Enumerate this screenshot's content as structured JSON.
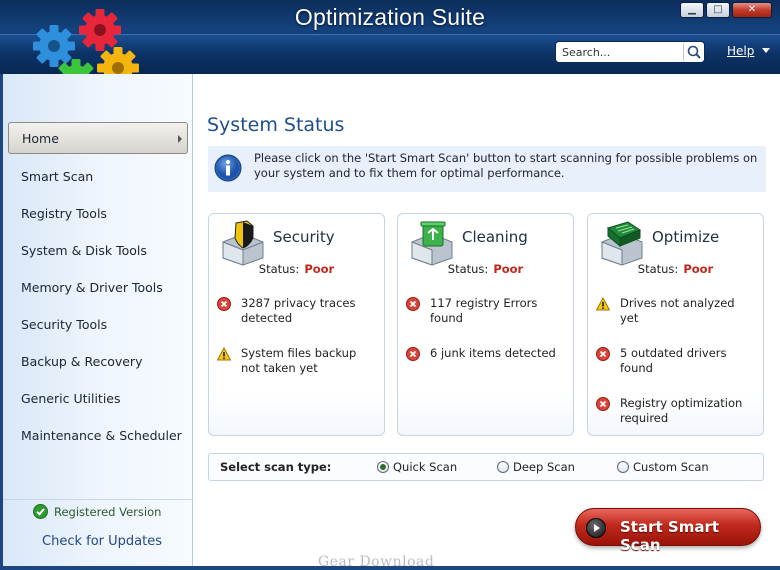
{
  "window": {
    "title": "Optimization Suite",
    "controls": {
      "minimize": "▁",
      "maximize": "□",
      "close": "✕"
    }
  },
  "header": {
    "search": {
      "placeholder": "Search...",
      "value": ""
    },
    "help_label": "Help"
  },
  "sidebar": {
    "items": [
      {
        "label": "Home",
        "active": true
      },
      {
        "label": "Smart Scan"
      },
      {
        "label": "Registry Tools"
      },
      {
        "label": "System & Disk Tools"
      },
      {
        "label": "Memory & Driver Tools"
      },
      {
        "label": "Security Tools"
      },
      {
        "label": "Backup & Recovery"
      },
      {
        "label": "Generic Utilities"
      },
      {
        "label": "Maintenance & Scheduler"
      }
    ],
    "registered": "Registered Version",
    "check_updates": "Check for Updates"
  },
  "main": {
    "title": "System Status",
    "info": "Please click on the 'Start Smart Scan' button to start scanning for possible problems on your system and to fix them for optimal performance.",
    "status_label": "Status:",
    "cards": [
      {
        "title": "Security",
        "status": "Poor",
        "icon": "security-shield-box-icon",
        "issues": [
          {
            "icon": "error-icon",
            "text": "3287 privacy traces detected"
          },
          {
            "icon": "warning-icon",
            "text": "System files backup not taken yet"
          }
        ]
      },
      {
        "title": "Cleaning",
        "status": "Poor",
        "icon": "recycle-bin-box-icon",
        "issues": [
          {
            "icon": "error-icon",
            "text": "117 registry Errors found"
          },
          {
            "icon": "error-icon",
            "text": "6 junk items detected"
          }
        ]
      },
      {
        "title": "Optimize",
        "status": "Poor",
        "icon": "circuit-board-box-icon",
        "issues": [
          {
            "icon": "warning-icon",
            "text": "Drives not analyzed yet"
          },
          {
            "icon": "error-icon",
            "text": "5 outdated drivers found"
          },
          {
            "icon": "error-icon",
            "text": "Registry optimization required"
          }
        ]
      }
    ],
    "scan_type": {
      "label": "Select scan type:",
      "options": [
        {
          "label": "Quick Scan",
          "selected": true
        },
        {
          "label": "Deep Scan",
          "selected": false
        },
        {
          "label": "Custom Scan",
          "selected": false
        }
      ]
    },
    "start_button": "Start Smart Scan"
  },
  "watermark": "Gear Download",
  "colors": {
    "titlebar": "#0f3a72",
    "accent_title": "#1d4f8f",
    "poor": "#c0281c",
    "start_button": "#c0281c",
    "info_bg": "#e8f0fb"
  }
}
